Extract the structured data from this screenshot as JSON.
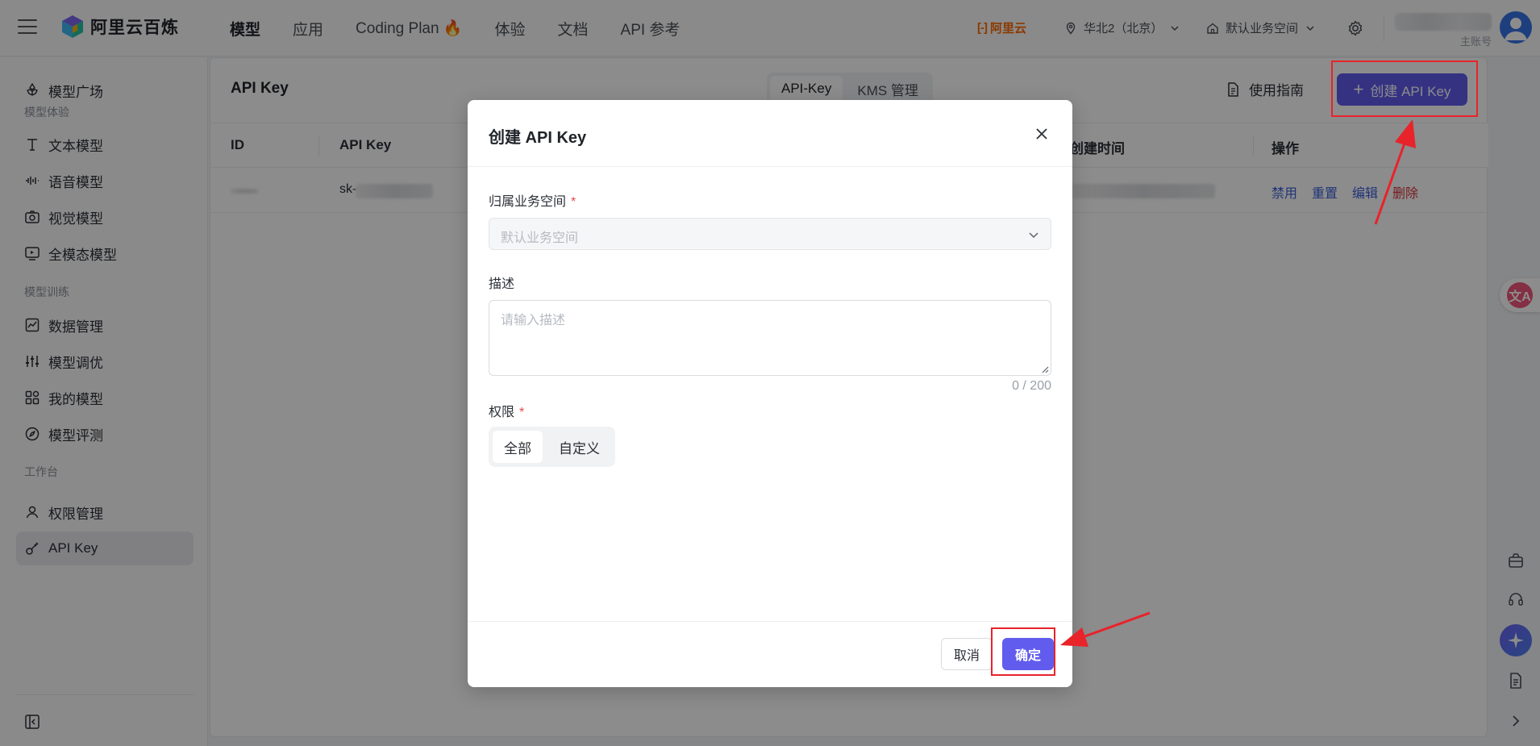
{
  "app": {
    "logo_text": "阿里云百炼"
  },
  "topnav": {
    "items": [
      {
        "label": "模型",
        "active": true
      },
      {
        "label": "应用",
        "active": false
      },
      {
        "label": "Coding Plan 🔥",
        "active": false
      },
      {
        "label": "体验",
        "active": false
      },
      {
        "label": "文档",
        "active": false
      },
      {
        "label": "API 参考",
        "active": false
      }
    ]
  },
  "header": {
    "brand": "阿里云",
    "region": "华北2（北京）",
    "workspace": "默认业务空间",
    "account_label": "主账号"
  },
  "sidebar": {
    "items": [
      {
        "label": "模型广场",
        "icon": "model-square-icon"
      },
      {
        "group": "模型体验"
      },
      {
        "label": "文本模型",
        "icon": "text-icon"
      },
      {
        "label": "语音模型",
        "icon": "audio-wave-icon"
      },
      {
        "label": "视觉模型",
        "icon": "camera-icon"
      },
      {
        "label": "全模态模型",
        "icon": "omni-icon"
      },
      {
        "group": "模型训练"
      },
      {
        "label": "数据管理",
        "icon": "chart-icon"
      },
      {
        "label": "模型调优",
        "icon": "sliders-icon"
      },
      {
        "label": "我的模型",
        "icon": "grid-icon"
      },
      {
        "label": "模型评测",
        "icon": "compass-icon"
      },
      {
        "group": "工作台"
      },
      {
        "label": "权限管理",
        "icon": "user-icon"
      },
      {
        "label": "API Key",
        "icon": "key-icon",
        "active": true
      }
    ]
  },
  "page": {
    "title": "API Key",
    "tabs": [
      "API-Key",
      "KMS 管理"
    ],
    "active_tab": "API-Key",
    "guide_label": "使用指南",
    "create_label": "创建 API Key"
  },
  "table": {
    "columns": [
      "ID",
      "API Key",
      "创建时间",
      "操作"
    ],
    "rows": [
      {
        "api_key_prefix": "sk-"
      }
    ],
    "actions": [
      "禁用",
      "重置",
      "编辑",
      "删除"
    ]
  },
  "modal": {
    "title": "创建 API Key",
    "workspace_label": "归属业务空间",
    "workspace_value": "默认业务空间",
    "description_label": "描述",
    "description_placeholder": "请输入描述",
    "description_counter": "0 / 200",
    "permission_label": "权限",
    "permission_options": [
      "全部",
      "自定义"
    ],
    "permission_selected": "全部",
    "cancel_label": "取消",
    "ok_label": "确定",
    "required_mark": "*"
  },
  "colors": {
    "primary": "#615ced",
    "danger": "#d9363e",
    "annotation_red": "#e8232a",
    "brand_orange": "#ff6a00"
  },
  "fab": {
    "translate_glyph": "文A"
  }
}
